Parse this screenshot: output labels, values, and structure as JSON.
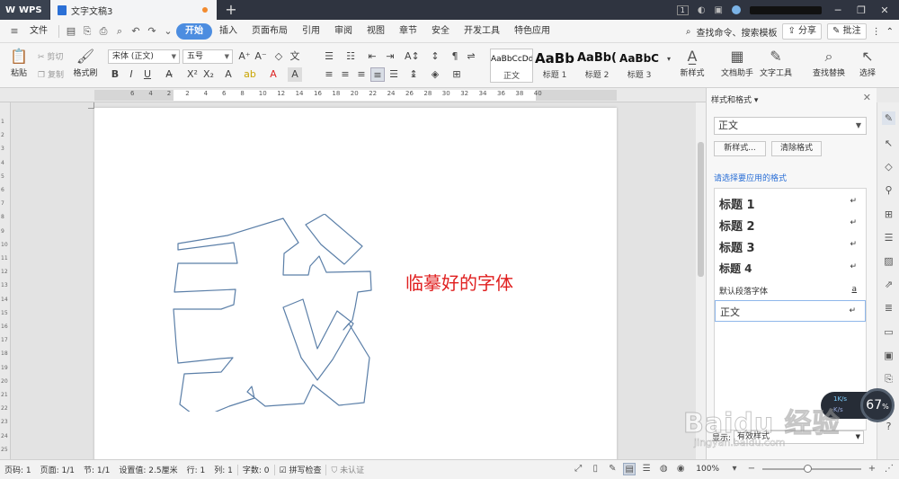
{
  "titlebar": {
    "app_name": "WPS",
    "doc_tab": "文字文稿3",
    "new_tab": "+",
    "badge": "1"
  },
  "menubar": {
    "file": "文件",
    "tabs": [
      "开始",
      "插入",
      "页面布局",
      "引用",
      "审阅",
      "视图",
      "章节",
      "安全",
      "开发工具",
      "特色应用"
    ],
    "active_tab": "开始",
    "search": "查找命令、搜索模板",
    "share": "分享",
    "comment": "批注"
  },
  "ribbon": {
    "paste": "粘贴",
    "cut": "剪切",
    "copy": "复制",
    "format_painter": "格式刷",
    "font_name": "宋体 (正文)",
    "font_size": "五号",
    "bold": "B",
    "italic": "I",
    "underline": "U",
    "styles": [
      {
        "sample": "AaBbCcDd",
        "name": "正文"
      },
      {
        "sample": "AaBb",
        "name": "标题 1"
      },
      {
        "sample": "AaBb(",
        "name": "标题 2"
      },
      {
        "sample": "AaBbC",
        "name": "标题 3"
      }
    ],
    "new_style": "新样式",
    "doc_helper": "文档助手",
    "text_tools": "文字工具",
    "find_replace": "查找替换",
    "select": "选择"
  },
  "ruler": {
    "numbers": [
      "6",
      "4",
      "2",
      "2",
      "4",
      "6",
      "8",
      "10",
      "12",
      "14",
      "16",
      "18",
      "20",
      "22",
      "24",
      "26",
      "28",
      "30",
      "32",
      "34",
      "36",
      "38",
      "40"
    ]
  },
  "vruler": {
    "numbers": [
      "1",
      "2",
      "3",
      "4",
      "5",
      "6",
      "7",
      "8",
      "9",
      "10",
      "11",
      "12",
      "13",
      "14",
      "15",
      "16",
      "17",
      "18",
      "19",
      "20",
      "21",
      "22",
      "23",
      "24",
      "25"
    ]
  },
  "document": {
    "annotation": "临摹好的字体",
    "outline_char": "我"
  },
  "panel": {
    "title": "样式和格式",
    "current_style": "正文",
    "new_style_btn": "新样式...",
    "clear_format_btn": "清除格式",
    "hint": "请选择要应用的格式",
    "items": [
      {
        "label": "标题  1",
        "mark": "↵"
      },
      {
        "label": "标题  2",
        "mark": "↵"
      },
      {
        "label": "标题  3",
        "mark": "↵"
      },
      {
        "label": "标题  4",
        "mark": "↵"
      },
      {
        "label": "默认段落字体",
        "mark": "a"
      },
      {
        "label": "正文",
        "mark": "↵"
      }
    ],
    "show_label": "显示:",
    "show_value": "有效样式"
  },
  "speed": {
    "percent": "67",
    "unit": "%",
    "up": "1K/s",
    "down": "K/s"
  },
  "watermark": {
    "main": "Baidu 经验",
    "url": "jingyan.baidu.com"
  },
  "statusbar": {
    "page_code": "页码: 1",
    "pages": "页面: 1/1",
    "section": "节: 1/1",
    "setting": "设置值: 2.5厘米",
    "row": "行: 1",
    "col": "列: 1",
    "word_count": "字数: 0",
    "spell_check": "拼写检查",
    "uncertified": "未认证",
    "zoom": "100%"
  },
  "colors": {
    "accent": "#4c8de0",
    "annotation": "#e02020",
    "outline": "#5b7fa8",
    "titlebar": "#2f3440"
  }
}
